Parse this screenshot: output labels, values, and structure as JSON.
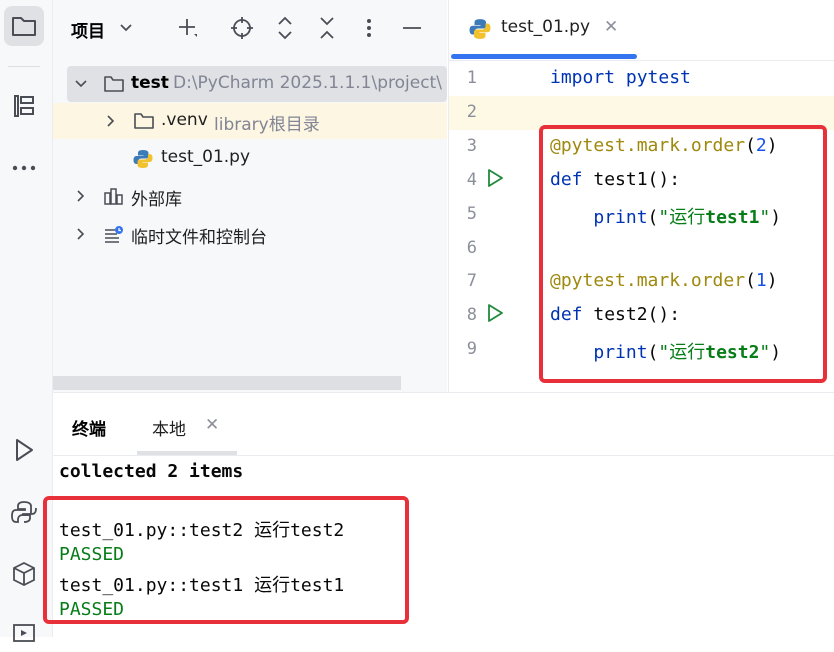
{
  "project_panel": {
    "title": "项目",
    "tree": [
      {
        "name": "test",
        "path": "D:\\PyCharm 2025.1.1.1\\project\\"
      },
      {
        "name": ".venv",
        "note": "library根目录"
      },
      {
        "name": "test_01.py"
      },
      {
        "name": "外部库"
      },
      {
        "name": "临时文件和控制台"
      }
    ]
  },
  "editor": {
    "tab": "test_01.py",
    "lines": [
      {
        "num": "1",
        "text": "import pytest"
      },
      {
        "num": "2",
        "text": ""
      },
      {
        "num": "3",
        "deco": "@pytest.mark.order",
        "open": "(",
        "arg": "2",
        "close": ")"
      },
      {
        "num": "4",
        "kw": "def",
        "rest": " test1():"
      },
      {
        "num": "5",
        "indent": "    ",
        "fn": "print",
        "open": "(",
        "str_q": "\"运行",
        "str_b": "test1",
        "str_end": "\"",
        "close": ")"
      },
      {
        "num": "6",
        "text": ""
      },
      {
        "num": "7",
        "deco": "@pytest.mark.order",
        "open": "(",
        "arg": "1",
        "close": ")"
      },
      {
        "num": "8",
        "kw": "def",
        "rest": " test2():"
      },
      {
        "num": "9",
        "indent": "    ",
        "fn": "print",
        "open": "(",
        "str_q": "\"运行",
        "str_b": "test2",
        "str_end": "\"",
        "close": ")"
      }
    ]
  },
  "terminal": {
    "title": "终端",
    "tab": "本地",
    "lines": [
      {
        "text": "collected 2 items"
      },
      {
        "text": ""
      },
      {
        "text": "test_01.py::test2 运行test2"
      },
      {
        "text": "PASSED"
      },
      {
        "text": "test_01.py::test1 运行test1"
      },
      {
        "text": "PASSED"
      }
    ]
  },
  "colors": {
    "accent": "#3574f0",
    "highlight_box": "#e8303a",
    "passed": "#067d17",
    "keyword": "#0033b3",
    "decorator": "#9e880d"
  }
}
